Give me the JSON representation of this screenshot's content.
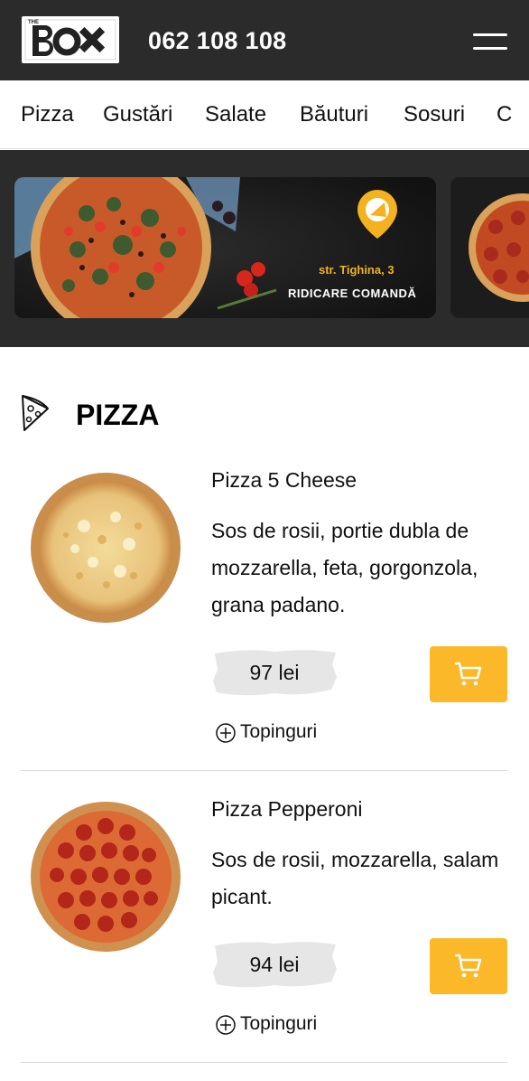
{
  "header": {
    "logo_text": "BOX",
    "logo_small": "THE",
    "phone": "062 108 108",
    "menu_icon": "hamburger-icon"
  },
  "categories": [
    "Pizza",
    "Gustări",
    "Salate",
    "Băuturi",
    "Sosuri",
    "C"
  ],
  "banner": {
    "address": "str. Tighina, 3",
    "cta": "RIDICARE COMANDĂ",
    "pin_icon": "location-pin-icon"
  },
  "section": {
    "title": "PIZZA",
    "icon": "pizza-slice-icon"
  },
  "products": [
    {
      "name": "Pizza 5 Cheese",
      "description": "Sos de rosii, portie dubla de mozzarella, feta, gorgonzola, grana padano.",
      "price": "97 lei",
      "toppings_label": "Topinguri",
      "cart_icon": "cart-icon"
    },
    {
      "name": "Pizza Pepperoni",
      "description": "Sos de rosii, mozzarella, salam picant.",
      "price": "94 lei",
      "toppings_label": "Topinguri",
      "cart_icon": "cart-icon"
    }
  ],
  "colors": {
    "header_bg": "#2b2b2b",
    "accent": "#fbb829",
    "price_bg": "#e6e6e6"
  }
}
